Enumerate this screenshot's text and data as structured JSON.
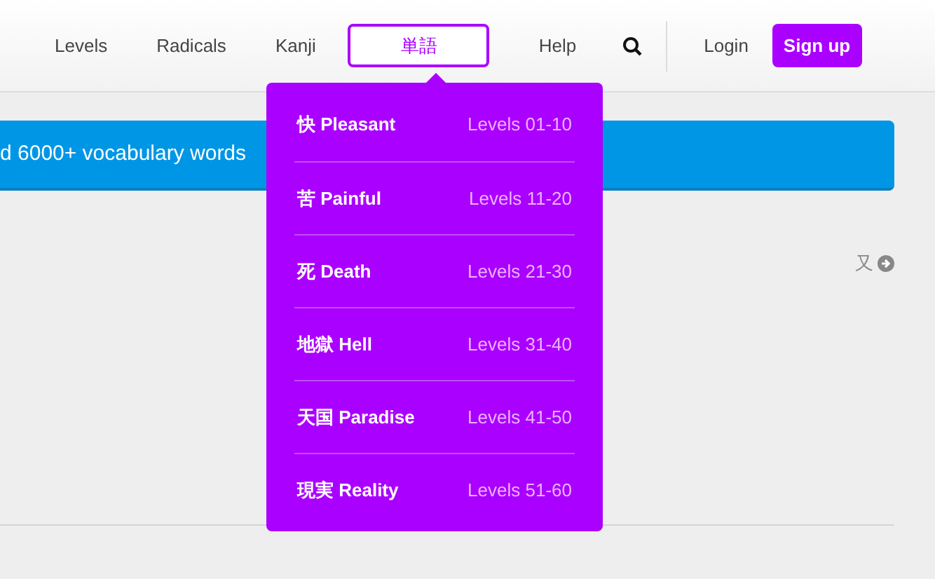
{
  "nav": {
    "items": [
      {
        "label": "Levels",
        "selected": false
      },
      {
        "label": "Radicals",
        "selected": false
      },
      {
        "label": "Kanji",
        "selected": false
      },
      {
        "label": "単語",
        "selected": true
      },
      {
        "label": "Help",
        "selected": false
      }
    ],
    "login": "Login",
    "signup": "Sign up"
  },
  "dropdown": {
    "items": [
      {
        "name": "快 Pleasant",
        "levels": "Levels 01-10"
      },
      {
        "name": "苦 Painful",
        "levels": "Levels 11-20"
      },
      {
        "name": "死 Death",
        "levels": "Levels 21-30"
      },
      {
        "name": "地獄 Hell",
        "levels": "Levels 31-40"
      },
      {
        "name": "天国 Paradise",
        "levels": "Levels 41-50"
      },
      {
        "name": "現実 Reality",
        "levels": "Levels 51-60"
      }
    ]
  },
  "banner": {
    "text": "d 6000+ vocabulary words"
  },
  "next_link": {
    "label": "又"
  }
}
